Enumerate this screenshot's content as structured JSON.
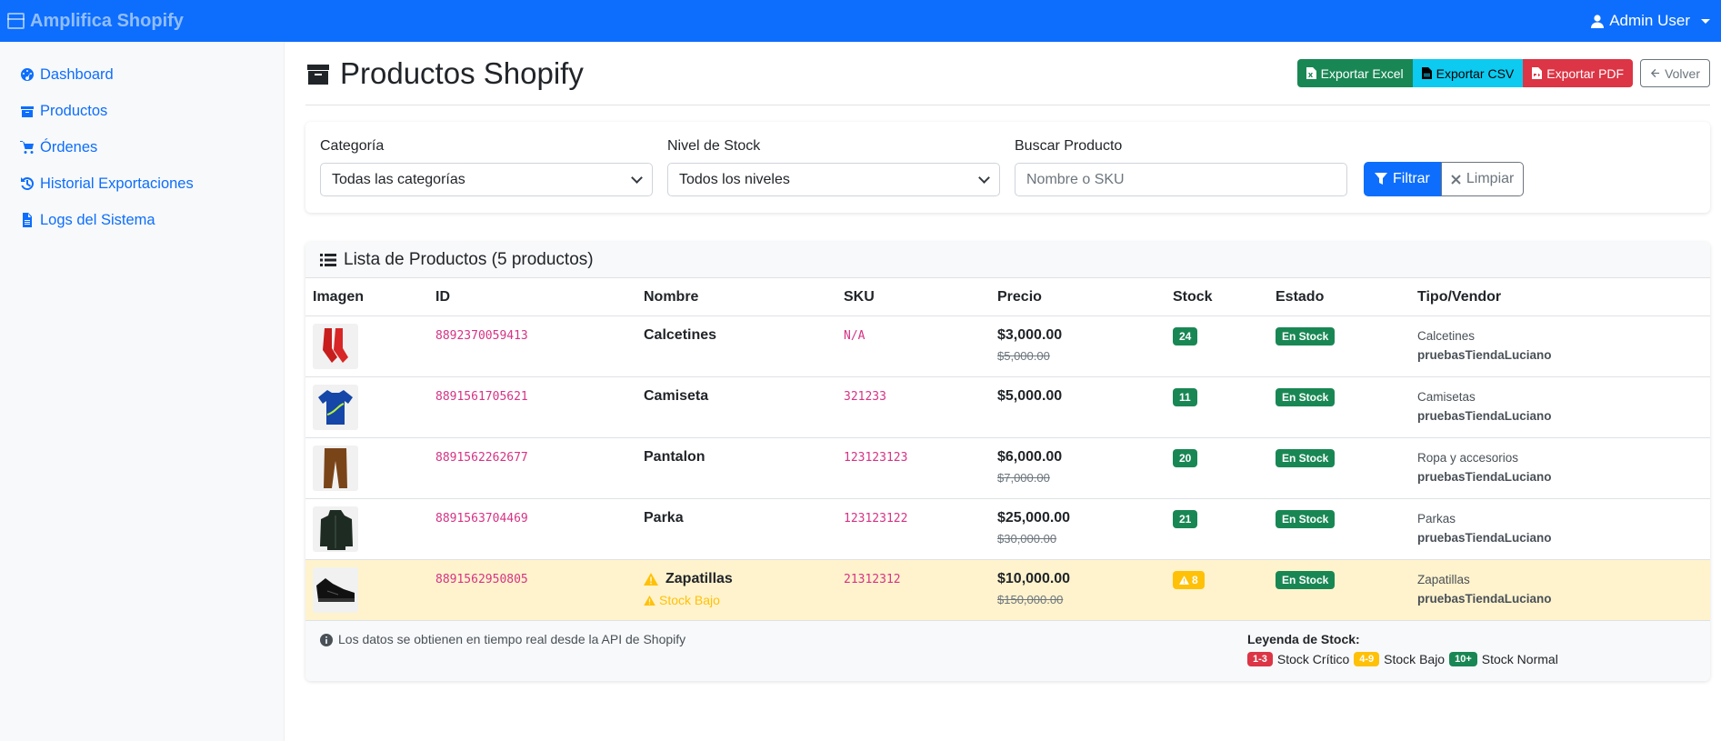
{
  "navbar": {
    "brand": "Amplifica Shopify",
    "user": "Admin User"
  },
  "sidebar": {
    "items": [
      {
        "label": "Dashboard",
        "icon": "tachometer-icon"
      },
      {
        "label": "Productos",
        "icon": "box-icon"
      },
      {
        "label": "Órdenes",
        "icon": "cart-icon"
      },
      {
        "label": "Historial Exportaciones",
        "icon": "history-icon"
      },
      {
        "label": "Logs del Sistema",
        "icon": "file-icon"
      }
    ]
  },
  "page": {
    "title": "Productos Shopify",
    "buttons": {
      "excel": "Exportar Excel",
      "csv": "Exportar CSV",
      "pdf": "Exportar PDF",
      "back": "Volver"
    }
  },
  "filters": {
    "category_label": "Categoría",
    "category_value": "Todas las categorías",
    "stock_label": "Nivel de Stock",
    "stock_value": "Todos los niveles",
    "search_label": "Buscar Producto",
    "search_placeholder": "Nombre o SKU",
    "filter_button": "Filtrar",
    "clear_button": "Limpiar"
  },
  "table": {
    "title": "Lista de Productos (5 productos)",
    "columns": [
      "Imagen",
      "ID",
      "Nombre",
      "SKU",
      "Precio",
      "Stock",
      "Estado",
      "Tipo/Vendor"
    ],
    "rows": [
      {
        "id": "8892370059413",
        "name": "Calcetines",
        "sku": "N/A",
        "price": "$3,000.00",
        "old_price": "$5,000.00",
        "stock": "24",
        "status": "En Stock",
        "type": "Calcetines",
        "vendor": "pruebasTiendaLuciano",
        "image": "socks"
      },
      {
        "id": "8891561705621",
        "name": "Camiseta",
        "sku": "321233",
        "price": "$5,000.00",
        "old_price": "",
        "stock": "11",
        "status": "En Stock",
        "type": "Camisetas",
        "vendor": "pruebasTiendaLuciano",
        "image": "tshirt"
      },
      {
        "id": "8891562262677",
        "name": "Pantalon",
        "sku": "123123123",
        "price": "$6,000.00",
        "old_price": "$7,000.00",
        "stock": "20",
        "status": "En Stock",
        "type": "Ropa y accesorios",
        "vendor": "pruebasTiendaLuciano",
        "image": "pants"
      },
      {
        "id": "8891563704469",
        "name": "Parka",
        "sku": "123123122",
        "price": "$25,000.00",
        "old_price": "$30,000.00",
        "stock": "21",
        "status": "En Stock",
        "type": "Parkas",
        "vendor": "pruebasTiendaLuciano",
        "image": "parka"
      },
      {
        "id": "8891562950805",
        "name": "Zapatillas",
        "sku": "21312312",
        "price": "$10,000.00",
        "old_price": "$150,000.00",
        "stock": "8",
        "status": "En Stock",
        "type": "Zapatillas",
        "vendor": "pruebasTiendaLuciano",
        "image": "shoes",
        "low_stock_label": "Stock Bajo"
      }
    ],
    "footer_info": "Los datos se obtienen en tiempo real desde la API de Shopify",
    "legend": {
      "title": "Leyenda de Stock:",
      "critical_badge": "1-3",
      "critical_label": "Stock Crítico",
      "low_badge": "4-9",
      "low_label": "Stock Bajo",
      "normal_badge": "10+",
      "normal_label": "Stock Normal"
    }
  },
  "colors": {
    "primary": "#0d6efd",
    "success": "#198754",
    "info": "#0dcaf0",
    "danger": "#dc3545",
    "warning": "#ffc107",
    "warning_bg": "#fff3cd"
  }
}
